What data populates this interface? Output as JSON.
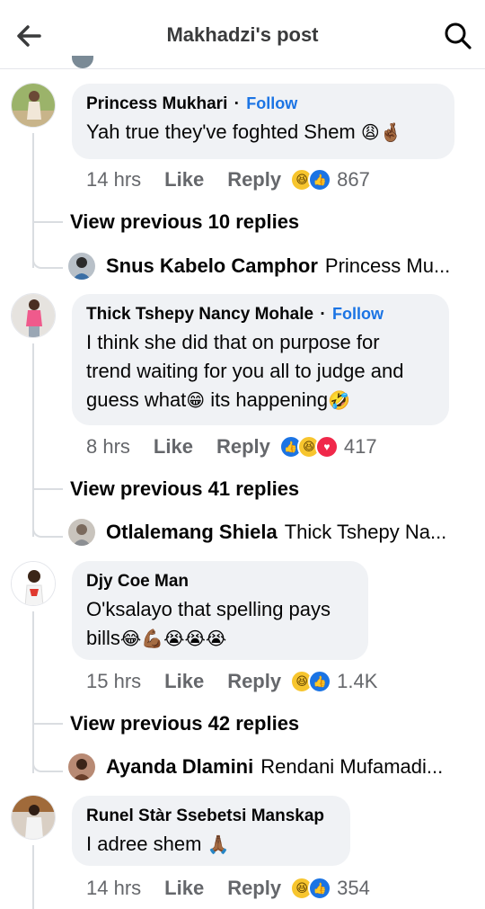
{
  "header": {
    "title": "Makhadzi's post",
    "back_icon": "arrow-left-icon",
    "search_icon": "search-icon"
  },
  "colors": {
    "link_blue": "#1b74e4",
    "bubble_bg": "#f0f2f5",
    "meta_gray": "#65676b",
    "thread_line": "#dadde1"
  },
  "comments": [
    {
      "author": "Princess Mukhari",
      "follow": "Follow",
      "text": "Yah true they've foghted Shem",
      "text_emojis": "😩🤞🏾",
      "time": "14 hrs",
      "like": "Like",
      "reply": "Reply",
      "reactions": [
        "haha",
        "like"
      ],
      "count": "867",
      "view_previous": "View previous 10 replies",
      "reply_name": "Snus Kabelo Camphor",
      "reply_text": "Princess Mu..."
    },
    {
      "author": "Thick Tshepy Nancy Mohale",
      "follow": "Follow",
      "text_lines": [
        "I think she did that on purpose for",
        "trend waiting for you all to judge and"
      ],
      "text_line3_a": "guess what",
      "text_line3_b": " its happening",
      "time": "8 hrs",
      "like": "Like",
      "reply": "Reply",
      "reactions": [
        "like",
        "haha",
        "love"
      ],
      "count": "417",
      "view_previous": "View previous 41 replies",
      "reply_name": "Otlalemang Shiela",
      "reply_text": "Thick Tshepy Na..."
    },
    {
      "author": "Djy Coe Man",
      "text_line1": "O'ksalayo that spelling pays",
      "text_line2": "bills",
      "text_emojis": "😂💪🏾😭😭😭",
      "time": "15 hrs",
      "like": "Like",
      "reply": "Reply",
      "reactions": [
        "haha",
        "like"
      ],
      "count": "1.4K",
      "view_previous": "View previous 42 replies",
      "reply_name": "Ayanda Dlamini",
      "reply_text": "Rendani Mufamadi..."
    },
    {
      "author": "Runel Stàr Ssebetsi Manskap",
      "text": "I adree shem",
      "text_emojis": "🙏🏾",
      "time": "14 hrs",
      "like": "Like",
      "reply": "Reply",
      "reactions": [
        "haha",
        "like"
      ],
      "count": "354"
    }
  ]
}
